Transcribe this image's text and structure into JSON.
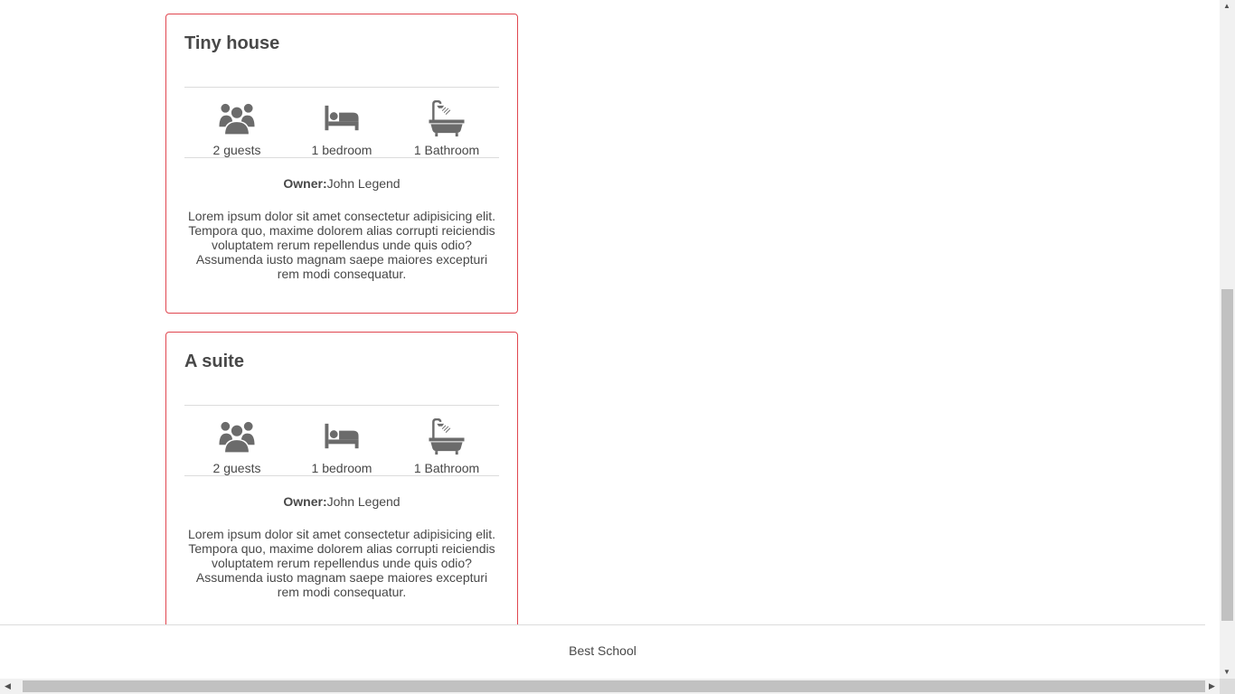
{
  "places": [
    {
      "title": "Tiny house",
      "guests": "2 guests",
      "bedrooms": "1 bedroom",
      "bathrooms": "1 Bathroom",
      "owner_label": "Owner:",
      "owner_name": "John Legend",
      "description": "Lorem ipsum dolor sit amet consectetur adipisicing elit. Tempora quo, maxime dolorem alias corrupti reiciendis voluptatem rerum repellendus unde quis odio? Assumenda iusto magnam saepe maiores excepturi rem modi consequatur."
    },
    {
      "title": "A suite",
      "guests": "2 guests",
      "bedrooms": "1 bedroom",
      "bathrooms": "1 Bathroom",
      "owner_label": "Owner:",
      "owner_name": "John Legend",
      "description": "Lorem ipsum dolor sit amet consectetur adipisicing elit. Tempora quo, maxime dolorem alias corrupti reiciendis voluptatem rerum repellendus unde quis odio? Assumenda iusto magnam saepe maiores excepturi rem modi consequatur."
    }
  ],
  "footer": {
    "text": "Best School"
  },
  "icons": {
    "guests": "group-icon",
    "bedroom": "bed-icon",
    "bathroom": "bathtub-icon"
  },
  "colors": {
    "card_border": "#e0464f",
    "text": "#484848",
    "icon": "#6b6b6b",
    "divider": "#dcdcdc"
  },
  "scrollbars": {
    "vertical_position": 0.6,
    "vertical_visible_fraction": 0.49
  }
}
